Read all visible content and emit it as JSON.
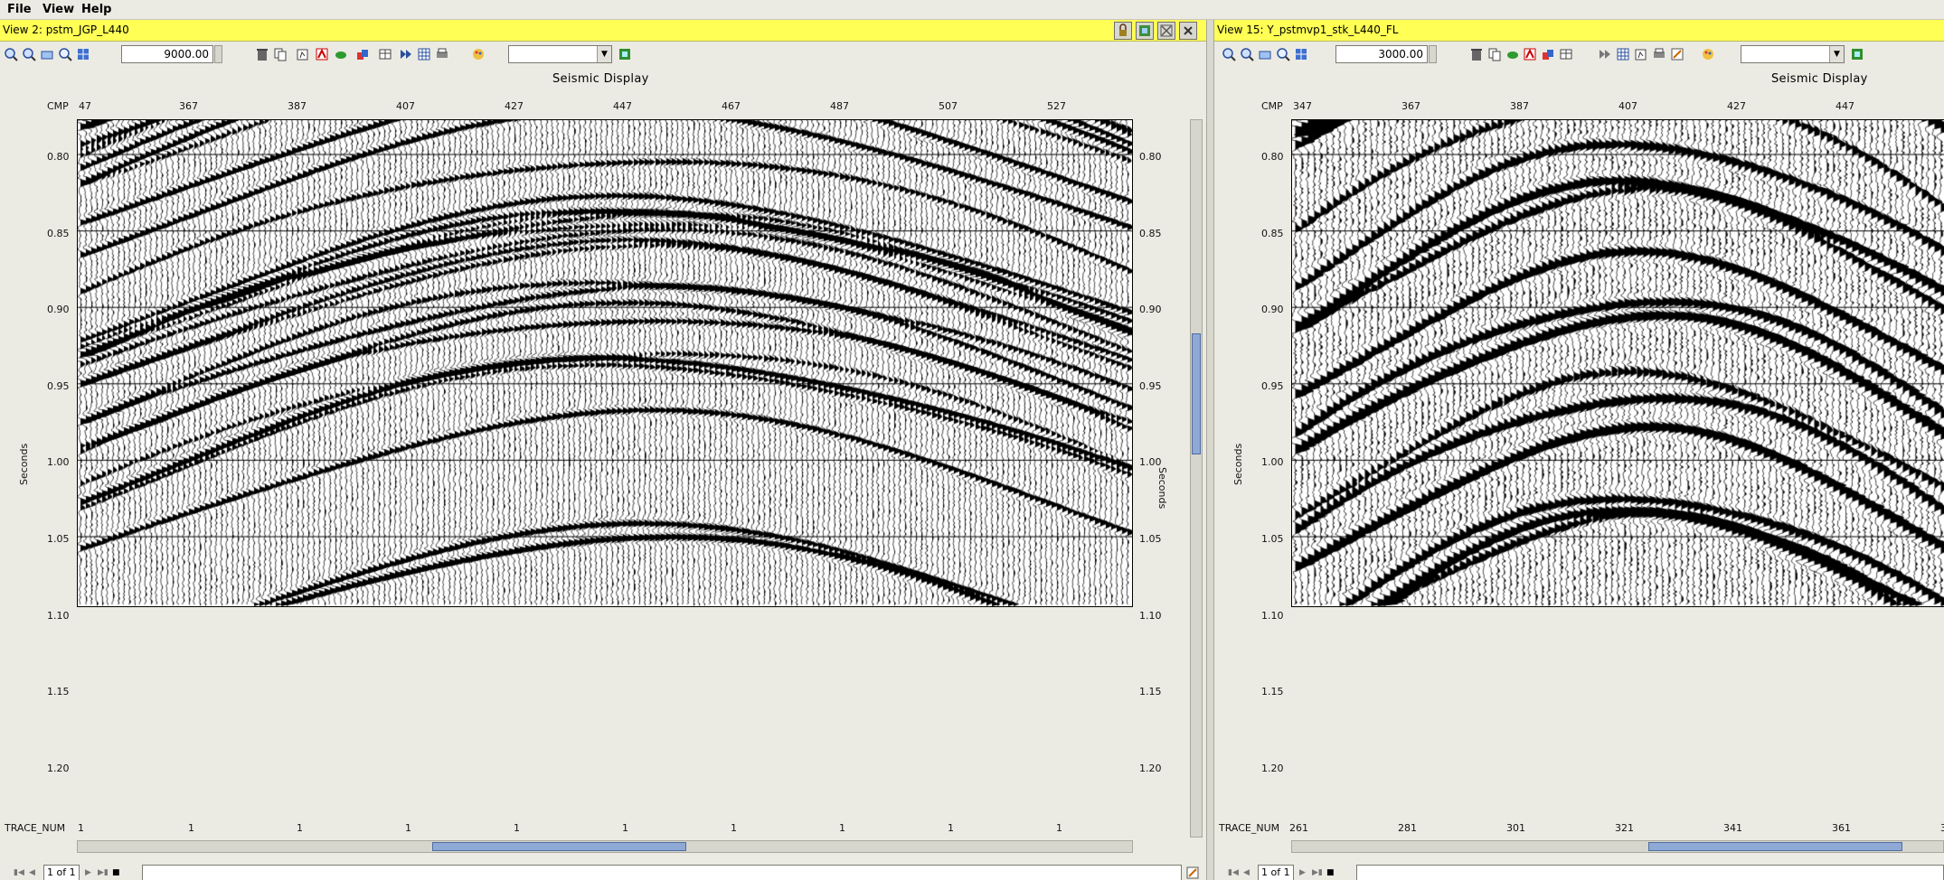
{
  "menubar": {
    "items": [
      "File",
      "View",
      "Help"
    ]
  },
  "left_view": {
    "title": "View 2: pstm_JGP_L440",
    "zoom_value": "9000.00",
    "display_title": "Seismic Display",
    "cmp_label": "CMP",
    "cmp_ticks": [
      "47",
      "367",
      "387",
      "407",
      "427",
      "447",
      "467",
      "487",
      "507",
      "527"
    ],
    "time_ticks": [
      "0.80",
      "0.85",
      "0.90",
      "0.95",
      "1.00",
      "1.05",
      "1.10",
      "1.15",
      "1.20"
    ],
    "y_label": "Seconds",
    "y_label_right": "Seconds",
    "trace_label": "TRACE_NUM",
    "trace_ticks": [
      "1",
      "1",
      "1",
      "1",
      "1",
      "1",
      "1",
      "1",
      "1",
      "1"
    ],
    "page": "1 of 1"
  },
  "right_view": {
    "title": "View 15: Y_pstmvp1_stk_L440_FL",
    "zoom_value": "3000.00",
    "display_title": "Seismic Display",
    "cmp_label": "CMP",
    "cmp_ticks": [
      "347",
      "367",
      "387",
      "407",
      "427",
      "447"
    ],
    "time_ticks": [
      "0.80",
      "0.85",
      "0.90",
      "0.95",
      "1.00",
      "1.05",
      "1.10",
      "1.15",
      "1.20"
    ],
    "y_label": "Seconds",
    "trace_label": "TRACE_NUM",
    "trace_ticks": [
      "261",
      "281",
      "301",
      "321",
      "341",
      "361",
      "3"
    ],
    "page": "1 of 1"
  },
  "colors": {
    "titlebar": "#ffff55",
    "background": "#ecebe3",
    "scroll_thumb": "#8fa9d6"
  },
  "icons": [
    "zoom-in-icon",
    "zoom-out-icon",
    "zoom-box-icon",
    "zoom-reset-icon",
    "fit-icon",
    "delete-icon",
    "copy-icon",
    "plot-icon",
    "color-icon",
    "layers-icon",
    "export-icon",
    "forward-icon",
    "table-icon",
    "grid-icon",
    "print-icon",
    "palette-icon",
    "apply-icon",
    "lock-icon",
    "refresh-icon",
    "maximize-icon",
    "close-icon",
    "first-page-icon",
    "prev-page-icon",
    "next-page-icon",
    "last-page-icon",
    "stop-icon",
    "edit-icon"
  ]
}
